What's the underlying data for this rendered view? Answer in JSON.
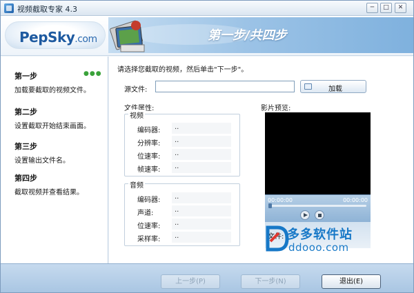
{
  "window": {
    "title": "视频截取专家 4.3",
    "controls": {
      "minimize": "─",
      "maximize": "□",
      "close": "✕"
    }
  },
  "header": {
    "logo_main": "PepSky",
    "logo_suffix": ".com",
    "step_title": "第一步/共四步"
  },
  "sidebar": {
    "steps": [
      {
        "name": "第一步",
        "desc": "加载要截取的视频文件。"
      },
      {
        "name": "第二步",
        "desc": "设置截取开始结束画面。"
      },
      {
        "name": "第三步",
        "desc": "设置输出文件名。"
      },
      {
        "name": "第四步",
        "desc": "截取视频并查看结果。"
      }
    ],
    "active_indicator": "●●●"
  },
  "main": {
    "instruction": "请选择您截取的视频，然后单击\"下一步\"。",
    "source_label": "源文件:",
    "source_value": "",
    "load_label": "加载",
    "props_label": "文件属性:",
    "video_group": {
      "title": "视频",
      "rows": [
        {
          "label": "编码器:",
          "value": ".."
        },
        {
          "label": "分辨率:",
          "value": ".."
        },
        {
          "label": "位速率:",
          "value": ".."
        },
        {
          "label": "帧速率:",
          "value": ".."
        }
      ]
    },
    "audio_group": {
      "title": "音频",
      "rows": [
        {
          "label": "编码器:",
          "value": ".."
        },
        {
          "label": "声道:",
          "value": ".."
        },
        {
          "label": "位速率:",
          "value": ".."
        },
        {
          "label": "采样率:",
          "value": ".."
        }
      ]
    },
    "preview_label": "影片预览:",
    "player": {
      "time_current": "00:00:00",
      "time_total": "00:00:00",
      "file_label": "文件:"
    }
  },
  "watermark": {
    "name": "多多软件站",
    "domain": "ddooo.com"
  },
  "footer": {
    "prev_label": "上一步(P)",
    "next_label": "下一步(N)",
    "exit_label": "退出(E)"
  },
  "colors": {
    "accent": "#1e5aa0",
    "header_band": "#9cc3e6",
    "footer": "#a9c6e3",
    "watermark": "#1778c7"
  }
}
